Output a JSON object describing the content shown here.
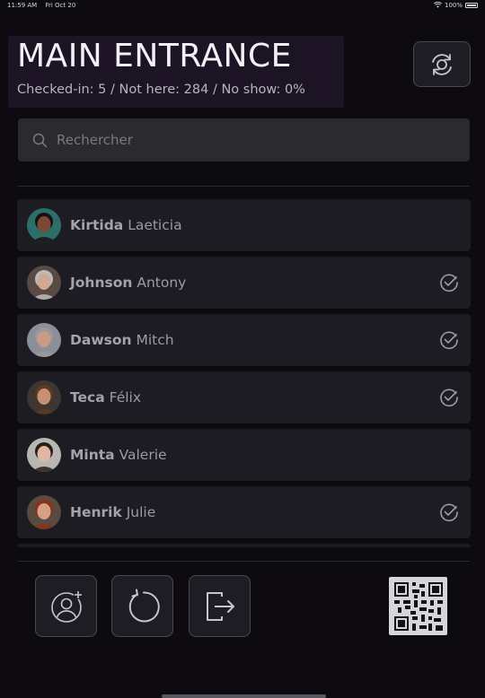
{
  "status_bar": {
    "time": "11:59 AM",
    "date": "Fri Oct 20",
    "battery": "100%"
  },
  "header": {
    "title": "MAIN ENTRANCE",
    "stats": "Checked-in: 5 / Not here: 284 / No show: 0%"
  },
  "search": {
    "placeholder": "Rechercher"
  },
  "attendees": [
    {
      "last": "Kirtida",
      "first": "Laeticia",
      "checked_in": false,
      "avatar_skin": "#7a4a34",
      "avatar_hair": "#1a1010",
      "avatar_bg": "#2d6e6a"
    },
    {
      "last": "Johnson",
      "first": "Antony",
      "checked_in": true,
      "avatar_skin": "#d1a891",
      "avatar_hair": "#bcbcbc",
      "avatar_bg": "#5a4a44"
    },
    {
      "last": "Dawson",
      "first": "Mitch",
      "checked_in": true,
      "avatar_skin": "#c99b86",
      "avatar_hair": "#9a9a9a",
      "avatar_bg": "#8a8f99"
    },
    {
      "last": "Teca",
      "first": "Félix",
      "checked_in": true,
      "avatar_skin": "#c79072",
      "avatar_hair": "#5a3a22",
      "avatar_bg": "#3e3631"
    },
    {
      "last": "Minta",
      "first": "Valerie",
      "checked_in": false,
      "avatar_skin": "#e0b7a3",
      "avatar_hair": "#2a1c16",
      "avatar_bg": "#b8b6b2"
    },
    {
      "last": "Henrik",
      "first": "Julie",
      "checked_in": true,
      "avatar_skin": "#d9a088",
      "avatar_hair": "#8a3218",
      "avatar_bg": "#5a4a40"
    }
  ],
  "colors": {
    "background": "#0d0a10",
    "card": "#1d1c22",
    "header_block": "#1c1424"
  }
}
